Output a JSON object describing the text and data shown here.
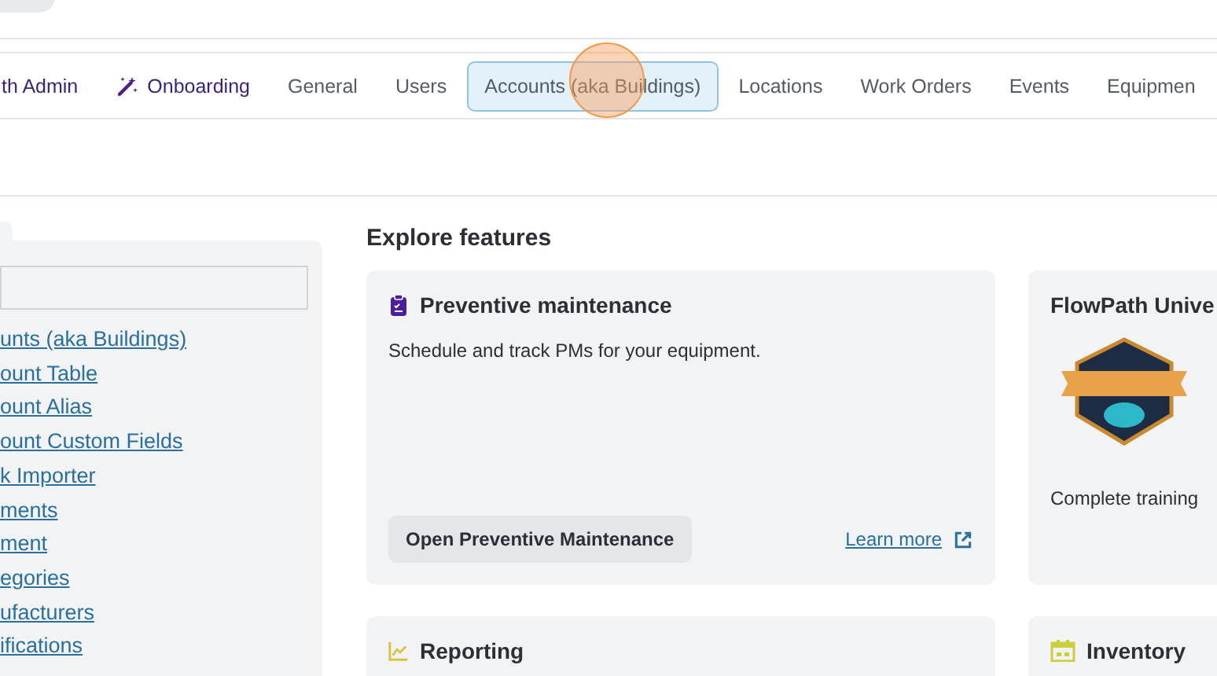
{
  "nav_tabs": [
    {
      "label": "th Admin",
      "kind": "accent",
      "selected": false
    },
    {
      "label": "Onboarding",
      "kind": "accent-wand",
      "selected": false
    },
    {
      "label": "General",
      "kind": "plain",
      "selected": false
    },
    {
      "label": "Users",
      "kind": "plain",
      "selected": false
    },
    {
      "label": "Accounts (aka Buildings)",
      "kind": "plain",
      "selected": true
    },
    {
      "label": "Locations",
      "kind": "plain",
      "selected": false
    },
    {
      "label": "Work Orders",
      "kind": "plain",
      "selected": false
    },
    {
      "label": "Events",
      "kind": "plain",
      "selected": false
    },
    {
      "label": "Equipmen",
      "kind": "plain",
      "selected": false
    }
  ],
  "sidebar": {
    "links": [
      "unts (aka Buildings)",
      "ount Table",
      "ount Alias",
      "ount Custom Fields",
      "k Importer",
      "ments",
      "ment",
      "egories",
      "ufacturers",
      "ifications"
    ]
  },
  "features": {
    "heading": "Explore features",
    "cards": [
      {
        "kind": "clipboard",
        "title": "Preventive maintenance",
        "description": "Schedule and track PMs for your equipment.",
        "button": "Open Preventive Maintenance",
        "link": "Learn more"
      },
      {
        "kind": "badge",
        "title": "FlowPath Unive",
        "description": "Complete training"
      },
      {
        "kind": "chart",
        "title": "Reporting"
      },
      {
        "kind": "calendar",
        "title": "Inventory"
      }
    ]
  }
}
